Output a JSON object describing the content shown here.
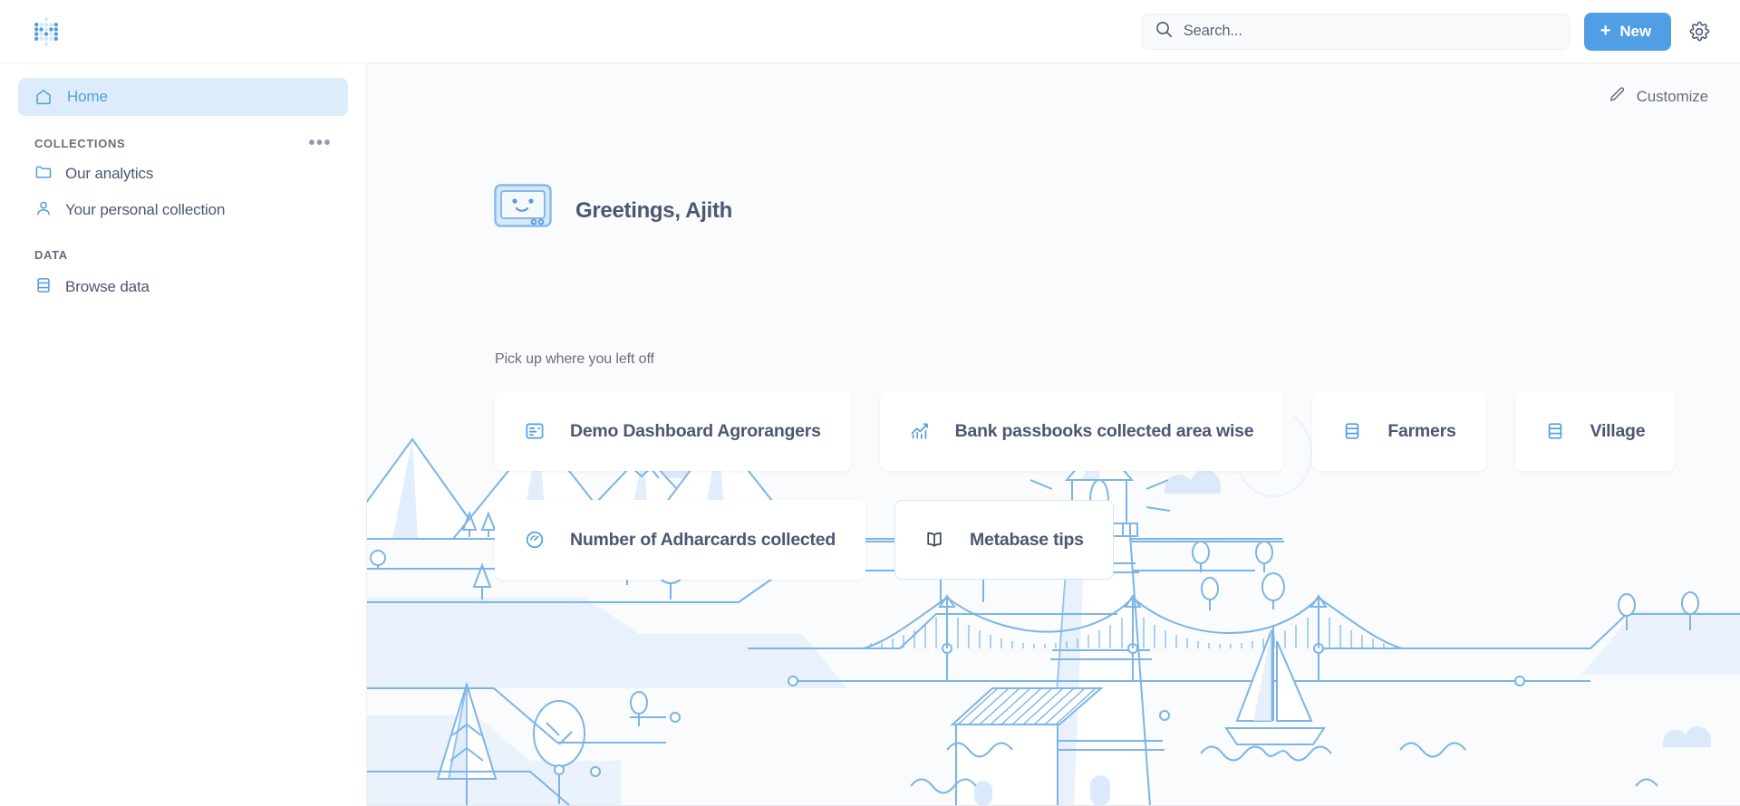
{
  "brand": {
    "logo_icon": "metabase-dots-logo",
    "accent_color": "#509ee3",
    "text_color": "#4c5773",
    "muted_color": "#696e7b",
    "sidebar_active_bg": "#ddecfa"
  },
  "header": {
    "search": {
      "icon": "search-icon",
      "placeholder": "Search...",
      "value": ""
    },
    "new_button": {
      "plus": "+",
      "label": "New",
      "icon": "plus-icon"
    },
    "settings": {
      "icon": "gear-icon",
      "label": "Settings"
    }
  },
  "sidebar": {
    "primary": [
      {
        "label": "Home",
        "icon": "home-icon",
        "active": true
      }
    ],
    "sections": [
      {
        "title": "COLLECTIONS",
        "action_icon": "ellipsis-icon",
        "items": [
          {
            "label": "Our analytics",
            "icon": "folder-icon"
          },
          {
            "label": "Your personal collection",
            "icon": "person-icon"
          }
        ]
      },
      {
        "title": "DATA",
        "action_icon": null,
        "items": [
          {
            "label": "Browse data",
            "icon": "database-icon"
          }
        ]
      }
    ]
  },
  "main": {
    "customize": {
      "label": "Customize",
      "icon": "pencil-icon"
    },
    "greeting": {
      "icon": "metabot-face-icon",
      "text": "Greetings, Ajith"
    },
    "recents": {
      "section_label": "Pick up where you left off",
      "cards": [
        {
          "label": "Demo Dashboard Agrorangers",
          "icon": "dashboard-icon",
          "style": "filled"
        },
        {
          "label": "Bank passbooks collected area wise",
          "icon": "line-chart-icon",
          "style": "filled"
        },
        {
          "label": "Farmers",
          "icon": "database-icon",
          "style": "filled"
        },
        {
          "label": "Village",
          "icon": "database-icon",
          "style": "filled"
        },
        {
          "label": "Number of Adharcards collected",
          "icon": "gauge-icon",
          "style": "filled"
        },
        {
          "label": "Metabase tips",
          "icon": "book-icon",
          "style": "outlined"
        }
      ]
    },
    "illustration": {
      "name": "metabase-lighthouse-landscape",
      "elements": [
        "mountains",
        "pine-trees",
        "round-trees",
        "lighthouse",
        "house",
        "suspension-bridge",
        "sailboat",
        "waves",
        "clouds"
      ]
    }
  }
}
